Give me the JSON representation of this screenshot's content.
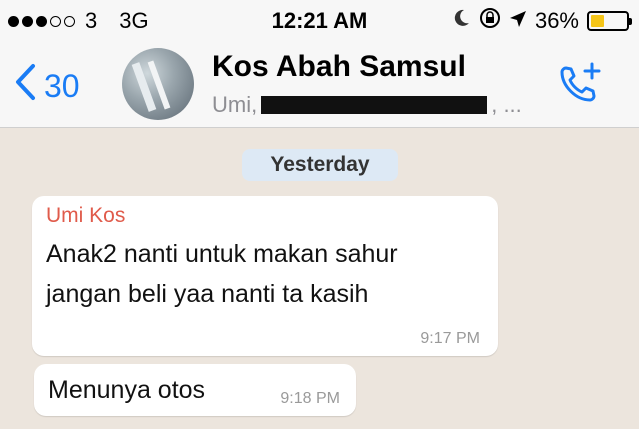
{
  "status_bar": {
    "carrier": "3",
    "network": "3G",
    "time": "12:21 AM",
    "battery_percent": "36%",
    "battery_level": 0.36,
    "signal_bars_filled": 3,
    "signal_bars_total": 5
  },
  "header": {
    "back_count": "30",
    "title": "Kos Abah Samsul",
    "subtitle_prefix": "Umi,",
    "subtitle_suffix": ", ..."
  },
  "chat": {
    "date_label": "Yesterday",
    "messages": [
      {
        "sender": "Umi Kos",
        "lines": [
          "Anak2 nanti untuk makan  sahur",
          "jangan beli yaa nanti ta kasih"
        ],
        "time": "9:17 PM"
      },
      {
        "lines": [
          "Menunya  otos"
        ],
        "time": "9:18 PM"
      }
    ]
  },
  "colors": {
    "accent": "#1a7cf5",
    "sender": "#e05b4b",
    "chat_bg": "#ece5dd",
    "date_pill": "#dde9f5",
    "battery": "#f5c518"
  }
}
